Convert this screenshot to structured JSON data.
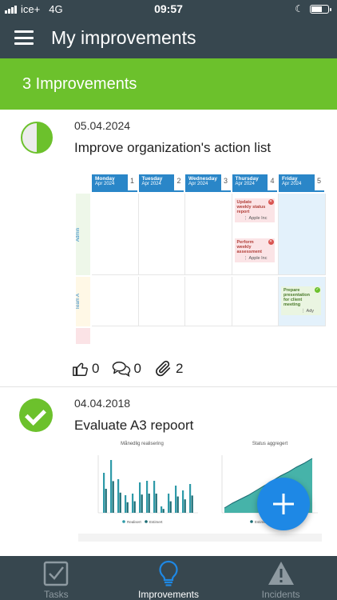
{
  "status_bar": {
    "carrier": "ice+",
    "network": "4G",
    "time": "09:57"
  },
  "header": {
    "title": "My improvements"
  },
  "summary": {
    "count_label": "3 Improvements"
  },
  "improvements": [
    {
      "date": "05.04.2024",
      "title": "Improve organization's action list",
      "progress": 0.5,
      "likes": "0",
      "comments": "0",
      "attachments": "2",
      "board": {
        "columns": [
          {
            "day": "Monday",
            "sub": "Apr 2024",
            "num": "1"
          },
          {
            "day": "Tuesday",
            "sub": "Apr 2024",
            "num": "2"
          },
          {
            "day": "Wednesday",
            "sub": "Apr 2024",
            "num": "3"
          },
          {
            "day": "Thursday",
            "sub": "Apr 2024",
            "num": "4"
          },
          {
            "day": "Friday",
            "sub": "Apr 2024",
            "num": "5"
          }
        ],
        "rows": [
          "Admin",
          "Team A"
        ],
        "cards": [
          {
            "text": "Update weekly status report",
            "owner": "Apple Inc"
          },
          {
            "text": "Perform weekly assessment",
            "owner": "Apple Inc"
          },
          {
            "text": "Prepare presentation for client meeting",
            "owner": "Ady"
          }
        ]
      }
    },
    {
      "date": "04.04.2018",
      "title": "Evaluate A3 repoort",
      "progress": 1.0,
      "charts": {
        "left_title": "Månedlig realisering",
        "right_title": "Status aggregert",
        "legend_left": [
          "Realisert",
          "Estimert"
        ],
        "legend_right": [
          "Estimert"
        ]
      }
    }
  ],
  "fab": {
    "label": "+"
  },
  "tabs": [
    {
      "label": "Tasks",
      "icon": "checkbox-icon",
      "active": false
    },
    {
      "label": "Improvements",
      "icon": "lightbulb-icon",
      "active": true
    },
    {
      "label": "Incidents",
      "icon": "warning-icon",
      "active": false
    }
  ],
  "colors": {
    "header": "#37474f",
    "accent_green": "#6cc12c",
    "accent_blue": "#1e88e5"
  }
}
